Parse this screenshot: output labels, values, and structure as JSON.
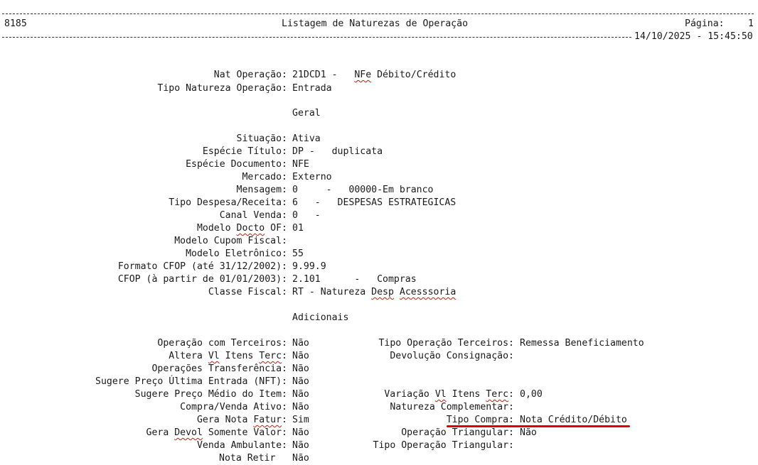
{
  "header": {
    "code": "8185",
    "title": "Listagem de Naturezas de Operação",
    "page_label": "Página:",
    "page_number": "1",
    "datetime": "14/10/2025 - 15:45:50"
  },
  "nat": {
    "rows": [
      {
        "label": "Nat Operação:",
        "value_a": "21DCD1 -   ",
        "value_b": "NFe",
        "value_c": " Débito/Crédito"
      },
      {
        "label": "Tipo Natureza Operação:",
        "value": "Entrada"
      }
    ]
  },
  "sections": {
    "geral": "Geral",
    "adicionais": "Adicionais"
  },
  "geral": {
    "situacao": {
      "label": "Situação:",
      "value": "Ativa"
    },
    "especie_titulo": {
      "label": "Espécie Título:",
      "value": "DP -   duplicata"
    },
    "especie_documento": {
      "label": "Espécie Documento:",
      "value": "NFE"
    },
    "mercado": {
      "label": "Mercado:",
      "value": "Externo"
    },
    "mensagem": {
      "label": "Mensagem:",
      "value": "0     -   00000-Em branco"
    },
    "tipo_despesa": {
      "label": "Tipo Despesa/Receita:",
      "value": "6   -   DESPESAS ESTRATEGICAS"
    },
    "canal_venda": {
      "label": "Canal Venda:",
      "value": "0   -"
    },
    "modelo_docto": {
      "label_a": "Modelo ",
      "label_b": "Docto",
      "label_c": " OF:",
      "value": "01"
    },
    "modelo_cupom": {
      "label": "Modelo Cupom Fiscal:",
      "value": ""
    },
    "modelo_eletronico": {
      "label": "Modelo Eletrônico:",
      "value": "55"
    },
    "formato_cfop": {
      "label": "Formato CFOP (até 31/12/2002):",
      "value": "9.99.9"
    },
    "cfop": {
      "label": "CFOP (à partir de 01/01/2003):",
      "value": "2.101      -   Compras"
    },
    "classe_fiscal": {
      "label": "Classe Fiscal:",
      "value_a": "RT - Natureza ",
      "value_b": "Desp",
      "value_c": " ",
      "value_d": "Acesssoria"
    }
  },
  "adicionais": {
    "left": [
      {
        "label": "Operação com Terceiros:",
        "value": "Não"
      },
      {
        "label_a": "Altera ",
        "label_b": "Vl",
        "label_c": " Itens ",
        "label_d": "Terc",
        "label_e": ":",
        "value": "Não"
      },
      {
        "label": "Operações Transferência:",
        "value": "Não"
      },
      {
        "label": "Sugere Preço Última Entrada (NFT):",
        "value": "Não"
      },
      {
        "label": "Sugere Preço Médio do Item:",
        "value": "Não"
      },
      {
        "label": "Compra/Venda Ativo:",
        "value": "Não"
      },
      {
        "label_a": "Gera Nota ",
        "label_b": "Fatur",
        "label_c": ":",
        "value": "Sim"
      },
      {
        "label_a": "Gera ",
        "label_b": "Devol",
        "label_c": " Somente Valor:",
        "value": "Não"
      },
      {
        "label": "Venda Ambulante:",
        "value": "Não"
      },
      {
        "label": "Nota Retir",
        "value": "Não"
      }
    ],
    "right": [
      {
        "label": "Tipo Operação Terceiros:",
        "value": "Remessa Beneficiamento"
      },
      {
        "label": "Devolução Consignação:",
        "value": ""
      },
      {
        "label_a": "Variação ",
        "label_b": "Vl",
        "label_c": " Itens ",
        "label_d": "Terc",
        "label_e": ":",
        "value": "0,00"
      },
      {
        "label": "Natureza Complementar:",
        "value": ""
      },
      {
        "label": "Tipo Compra:",
        "value": "Nota Crédito/Débito"
      },
      {
        "label": "Operação Triangular:",
        "value": "Não"
      },
      {
        "label": "Tipo Operação Triangular:",
        "value": ""
      }
    ]
  },
  "colors": {
    "annotation": "#e00000",
    "spellcheck": "#d11"
  }
}
